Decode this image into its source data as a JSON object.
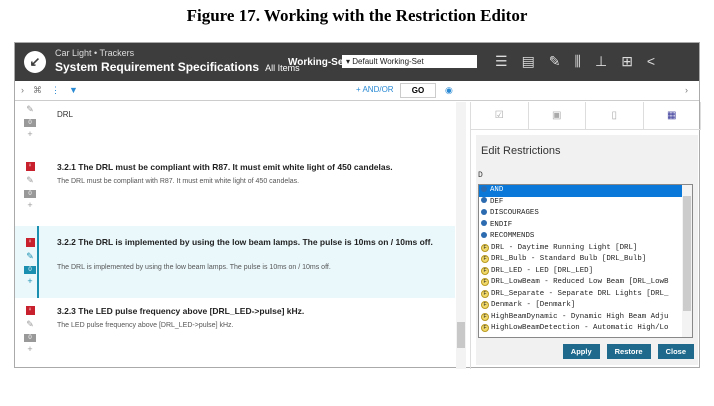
{
  "figure_title": "Figure 17. Working with the Restriction Editor",
  "header": {
    "breadcrumb": "Car Light • Trackers",
    "title": "System Requirement Specifications",
    "view": "All Items",
    "working_set_label": "Working-Set:",
    "working_set_value": "Default Working-Set"
  },
  "toolbar": {
    "and_or": "+ AND/OR",
    "go": "GO"
  },
  "items": [
    {
      "title": "DRL",
      "body": "",
      "count": "0"
    },
    {
      "title": "3.2.1 The DRL must be compliant with R87. It must emit white light of 450 candelas.",
      "body": "The DRL must be compliant with R87. It must emit white light of 450 candelas.",
      "count": "0"
    },
    {
      "title": "3.2.2 The DRL is implemented by using the low beam lamps. The pulse is 10ms on / 10ms off.",
      "body": "The DRL is implemented by using the low beam lamps. The pulse is 10ms on / 10ms off.",
      "count": "0"
    },
    {
      "title": "3.2.3 The LED pulse frequency above [DRL_LED->pulse] kHz.",
      "body": "The LED pulse frequency above [DRL_LED->pulse] kHz.",
      "count": "0"
    }
  ],
  "restrictions": {
    "heading": "Edit Restrictions",
    "input": "D",
    "options": [
      "AND",
      "DEF",
      "DISCOURAGES",
      "ENDIF",
      "RECOMMENDS",
      "DRL - Daytime Running Light [DRL]",
      "DRL_Bulb - Standard Bulb [DRL_Bulb]",
      "DRL_LED - LED [DRL_LED]",
      "DRL_LowBeam - Reduced Low Beam [DRL_LowB",
      "DRL_Separate - Separate DRL Lights [DRL_",
      "Denmark -  [Denmark]",
      "HighBeamDynamic - Dynamic High Beam Adju",
      "HighLowBeamDetection - Automatic High/Lo"
    ],
    "apply": "Apply",
    "restore": "Restore",
    "close": "Close"
  }
}
